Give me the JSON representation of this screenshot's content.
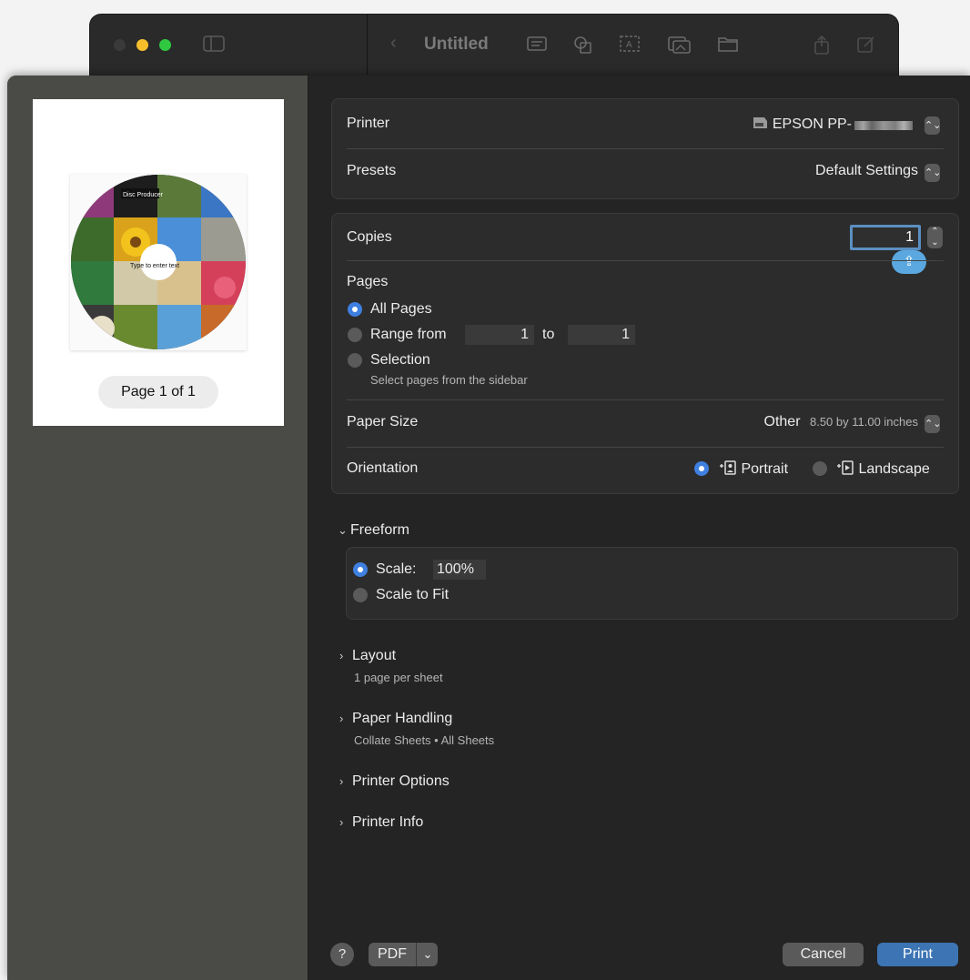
{
  "window": {
    "title": "Untitled",
    "traffic_colors": [
      "#3a3a3a",
      "#f5bf2c",
      "#2fc840"
    ]
  },
  "preview": {
    "page_label": "Page 1 of 1",
    "disc_brand": "Disc Producer",
    "disc_placeholder": "Type to enter text"
  },
  "printer": {
    "label": "Printer",
    "value": "EPSON PP-",
    "presets_label": "Presets",
    "presets_value": "Default Settings"
  },
  "copies": {
    "label": "Copies",
    "value": "1"
  },
  "pages": {
    "label": "Pages",
    "all_label": "All Pages",
    "range_label": "Range from",
    "range_from": "1",
    "to_label": "to",
    "range_to": "1",
    "selection_label": "Selection",
    "selection_hint": "Select pages from the sidebar",
    "selected": "All Pages"
  },
  "paper": {
    "label": "Paper Size",
    "value": "Other",
    "detail": "8.50 by 11.00 inches"
  },
  "orientation": {
    "label": "Orientation",
    "portrait": "Portrait",
    "landscape": "Landscape",
    "selected": "Portrait"
  },
  "freeform": {
    "title": "Freeform",
    "scale_label": "Scale:",
    "scale_value": "100%",
    "fit_label": "Scale to Fit",
    "selected": "Scale"
  },
  "sections": [
    {
      "title": "Layout",
      "subtitle": "1 page per sheet"
    },
    {
      "title": "Paper Handling",
      "subtitle": "Collate Sheets • All Sheets"
    },
    {
      "title": "Printer Options",
      "subtitle": ""
    },
    {
      "title": "Printer Info",
      "subtitle": ""
    }
  ],
  "footer": {
    "help": "?",
    "pdf": "PDF",
    "cancel": "Cancel",
    "print": "Print"
  },
  "colors": {
    "accent": "#3f7fe0",
    "print_button": "#3d74b4"
  }
}
